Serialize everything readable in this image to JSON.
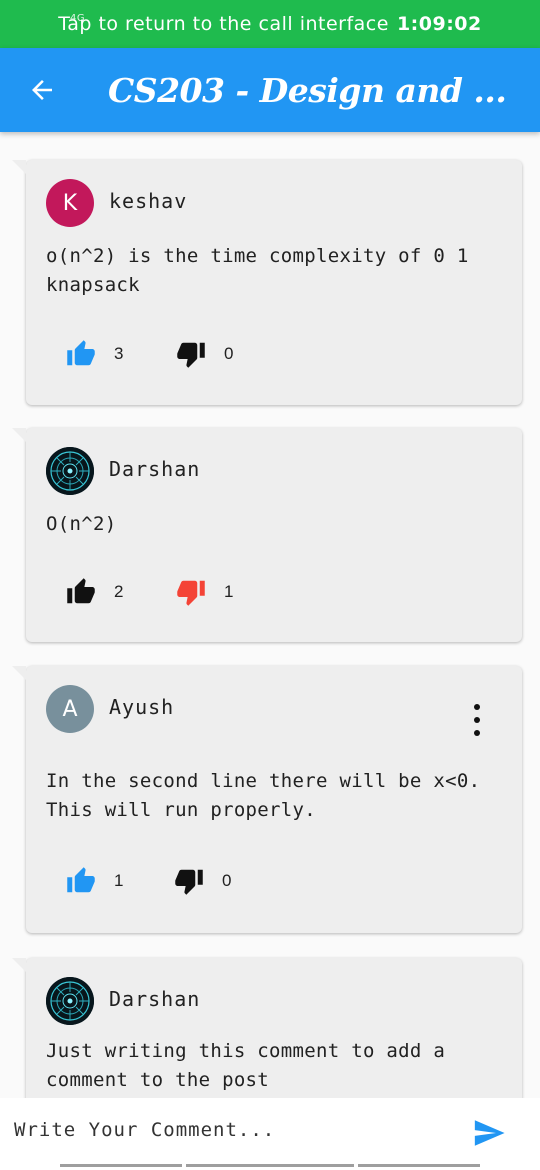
{
  "status_bar": {
    "signal_text": "4G",
    "message": "Tap to return to the call interface",
    "time": "1:09:02"
  },
  "app_bar": {
    "title": "CS203 - Design and ..."
  },
  "comments": [
    {
      "author": "keshav",
      "avatar_letter": "K",
      "avatar_color": "#c2185b",
      "text": "o(n^2) is the time complexity of 0 1 knapsack",
      "likes": "3",
      "dislikes": "0",
      "liked": true,
      "disliked": false
    },
    {
      "author": "Darshan",
      "avatar_letter": "",
      "avatar_image": "circuit-globe-avatar",
      "text": "O(n^2)",
      "likes": "2",
      "dislikes": "1",
      "liked": false,
      "disliked": true
    },
    {
      "author": "Ayush",
      "avatar_letter": "A",
      "avatar_color": "#78909c",
      "text": "In the second line there will be x<0. This will run properly.",
      "likes": "1",
      "dislikes": "0",
      "liked": true,
      "disliked": false,
      "has_menu": true
    },
    {
      "author": "Darshan",
      "avatar_letter": "",
      "avatar_image": "circuit-globe-avatar",
      "text": "Just writing this comment to add a comment to the post"
    }
  ],
  "input": {
    "placeholder": "Write Your Comment..."
  },
  "colors": {
    "status_bar": "#1fbb4e",
    "app_bar": "#2196f3",
    "like_active": "#2196f3",
    "dislike_active": "#f44336",
    "inactive_icon": "#111111"
  }
}
